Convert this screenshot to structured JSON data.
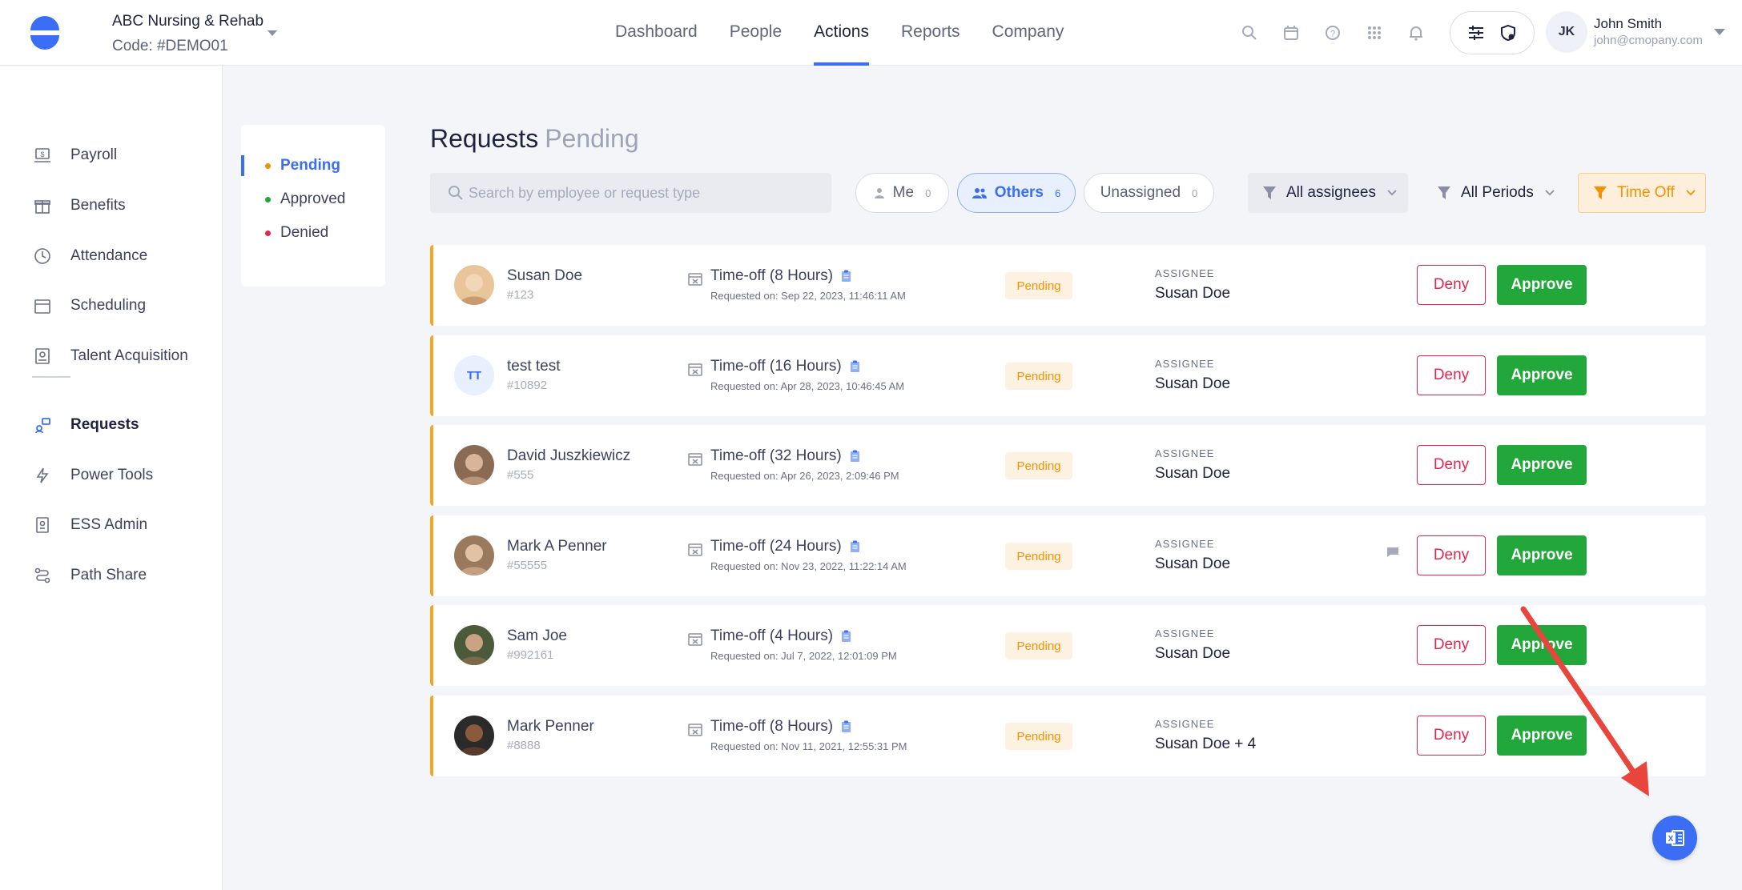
{
  "company": {
    "name": "ABC Nursing & Rehab",
    "code": "Code: #DEMO01"
  },
  "nav": [
    {
      "label": "Dashboard"
    },
    {
      "label": "People"
    },
    {
      "label": "Actions",
      "active": true
    },
    {
      "label": "Reports"
    },
    {
      "label": "Company"
    }
  ],
  "user": {
    "initials": "JK",
    "name": "John Smith",
    "email": "john@cmopany.com"
  },
  "sidebar": {
    "items": [
      {
        "label": "Payroll",
        "icon": "payroll-icon"
      },
      {
        "label": "Benefits",
        "icon": "gift-icon"
      },
      {
        "label": "Attendance",
        "icon": "clock-icon"
      },
      {
        "label": "Scheduling",
        "icon": "calendar-icon"
      },
      {
        "label": "Talent Acquisition",
        "icon": "talent-icon"
      },
      {
        "label": "Requests",
        "icon": "requests-icon",
        "active": true
      },
      {
        "label": "Power Tools",
        "icon": "bolt-icon"
      },
      {
        "label": "ESS Admin",
        "icon": "badge-icon"
      },
      {
        "label": "Path Share",
        "icon": "path-icon"
      }
    ]
  },
  "status_filter": {
    "items": [
      {
        "label": "Pending",
        "color": "#f39200",
        "active": true
      },
      {
        "label": "Approved",
        "color": "#22a83a"
      },
      {
        "label": "Denied",
        "color": "#e2264f"
      }
    ]
  },
  "page": {
    "title": "Requests",
    "subtitle": "Pending"
  },
  "search": {
    "placeholder": "Search by employee or request type"
  },
  "pills": {
    "me": {
      "label": "Me",
      "count": "0"
    },
    "others": {
      "label": "Others",
      "count": "6"
    },
    "unassigned": {
      "label": "Unassigned",
      "count": "0"
    }
  },
  "dropdowns": {
    "assignees": "All assignees",
    "periods": "All Periods",
    "type": "Time Off"
  },
  "assignee_label": "ASSIGNEE",
  "actions": {
    "deny": "Deny",
    "approve": "Approve"
  },
  "requests": [
    {
      "name": "Susan Doe",
      "id": "#123",
      "type": "Time-off (8 Hours)",
      "requested": "Requested on: Sep 22, 2023, 11:46:11 AM",
      "status": "Pending",
      "assignee": "Susan Doe",
      "avatar": "photo",
      "has_comment": false
    },
    {
      "name": "test test",
      "id": "#10892",
      "type": "Time-off (16 Hours)",
      "requested": "Requested on: Apr 28, 2023, 10:46:45 AM",
      "status": "Pending",
      "assignee": "Susan Doe",
      "avatar": "TT",
      "has_comment": false
    },
    {
      "name": "David Juszkiewicz",
      "id": "#555",
      "type": "Time-off (32 Hours)",
      "requested": "Requested on: Apr 26, 2023, 2:09:46 PM",
      "status": "Pending",
      "assignee": "Susan Doe",
      "avatar": "photo",
      "has_comment": false
    },
    {
      "name": "Mark A Penner",
      "id": "#55555",
      "type": "Time-off (24 Hours)",
      "requested": "Requested on: Nov 23, 2022, 11:22:14 AM",
      "status": "Pending",
      "assignee": "Susan Doe",
      "avatar": "photo",
      "has_comment": true
    },
    {
      "name": "Sam Joe",
      "id": "#992161",
      "type": "Time-off (4 Hours)",
      "requested": "Requested on: Jul 7, 2022, 12:01:09 PM",
      "status": "Pending",
      "assignee": "Susan Doe",
      "avatar": "photo",
      "has_comment": false
    },
    {
      "name": "Mark Penner",
      "id": "#8888",
      "type": "Time-off (8 Hours)",
      "requested": "Requested on: Nov 11, 2021, 12:55:31 PM",
      "status": "Pending",
      "assignee": "Susan Doe + 4",
      "avatar": "photo",
      "has_comment": false
    }
  ],
  "colors": {
    "accent": "#3b6ef5",
    "pending": "#f39200",
    "approve": "#22a83a",
    "deny": "#e2264f",
    "annotation_arrow": "#e8463c"
  }
}
